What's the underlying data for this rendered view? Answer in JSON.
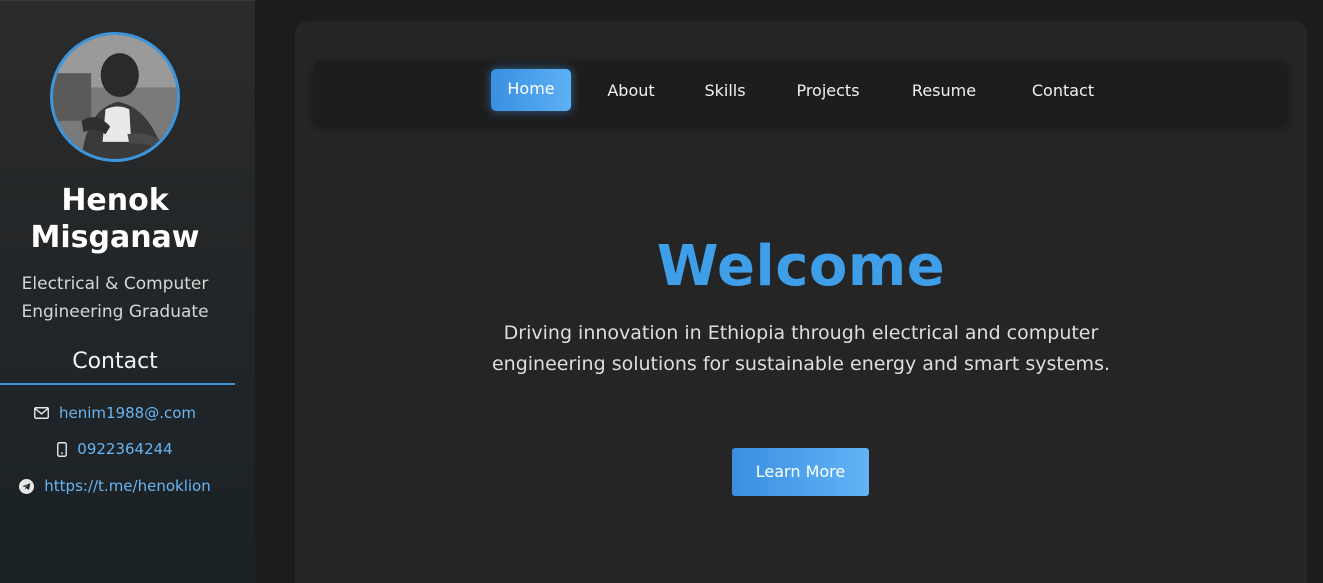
{
  "profile": {
    "name": "Henok Misganaw",
    "tagline": "Electrical & Computer Engineering Graduate"
  },
  "contact": {
    "heading": "Contact",
    "items": [
      {
        "icon": "mail-icon",
        "text": "henim1988@.com"
      },
      {
        "icon": "phone-icon",
        "text": "0922364244"
      },
      {
        "icon": "telegram-icon",
        "text": "https://t.me/henoklion"
      }
    ]
  },
  "nav": {
    "active": "Home",
    "items": [
      {
        "label": "Home"
      },
      {
        "label": "About"
      },
      {
        "label": "Skills"
      },
      {
        "label": "Projects"
      },
      {
        "label": "Resume"
      },
      {
        "label": "Contact"
      }
    ]
  },
  "hero": {
    "title": "Welcome",
    "text": "Driving innovation in Ethiopia through electrical and computer engineering solutions for sustainable energy and smart systems.",
    "button": "Learn More"
  },
  "colors": {
    "accent": "#3f9ee8",
    "link": "#6ab4f2",
    "background": "#1c1c1c",
    "card": "#252525"
  }
}
